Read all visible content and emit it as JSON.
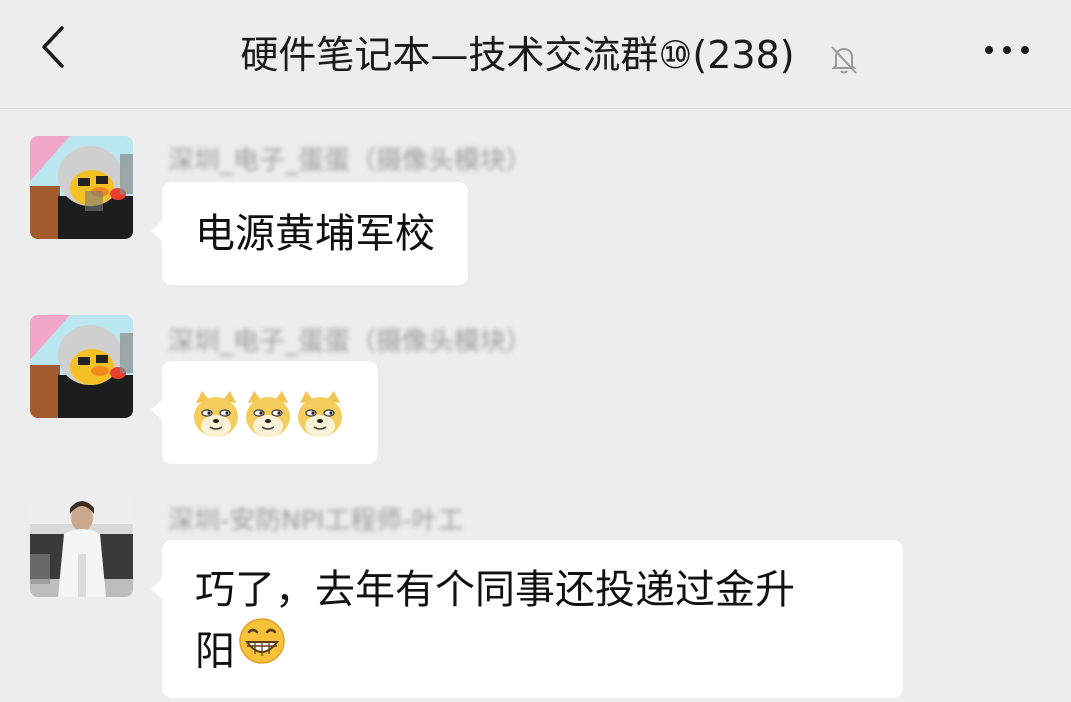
{
  "header": {
    "title": "硬件笔记本—技术交流群⑩(238)",
    "back_icon": "chevron-left-icon",
    "mute_icon": "bell-muted-icon",
    "more_icon": "more-dots-icon"
  },
  "messages": [
    {
      "sender": "深圳_电子_蛋蛋（摄像头模块）",
      "text": "电源黄埔军校",
      "avatar": "cartoon-duck-avatar"
    },
    {
      "sender": "深圳_电子_蛋蛋（摄像头模块）",
      "text": "",
      "emojis": [
        "doge-emoji",
        "doge-emoji",
        "doge-emoji"
      ],
      "avatar": "cartoon-duck-avatar"
    },
    {
      "sender": "深圳-安防NPI工程师-叶工",
      "text_line1": "巧了，去年有个同事还投递过金升",
      "text_line2": "阳",
      "trailing_emoji": "grin-emoji",
      "avatar": "photo-avatar"
    }
  ]
}
